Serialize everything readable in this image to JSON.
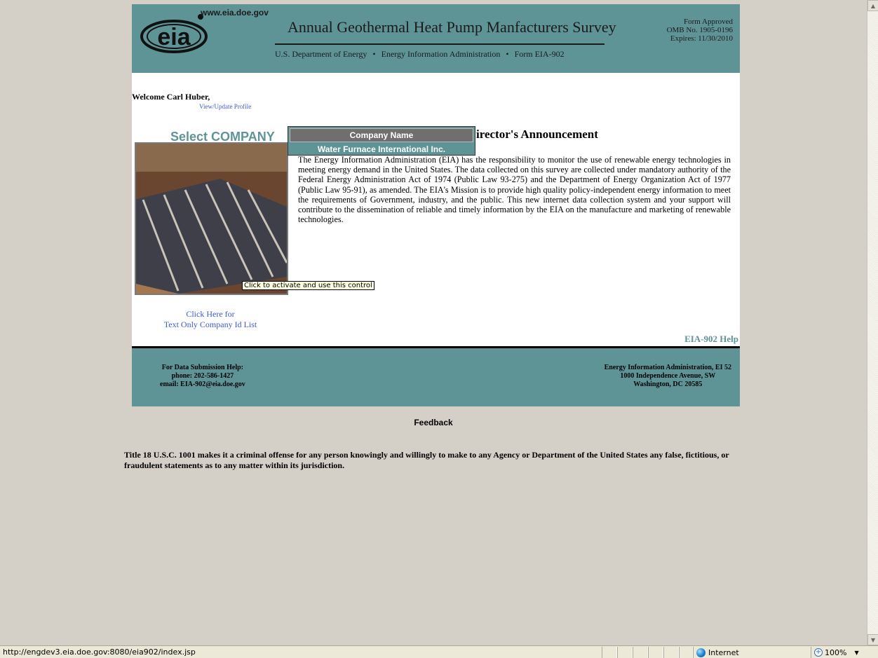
{
  "header": {
    "logo_text": "eia",
    "logo_url": "www.eia.doe.gov",
    "title": "Annual Geothermal Heat Pump Manfacturers Survey",
    "subtitle_dept": "U.S. Department of Energy",
    "subtitle_agency": "Energy Information Administration",
    "subtitle_form": "Form EIA-902",
    "subtitle_separator": "•",
    "form_approved": "Form Approved",
    "omb": "OMB No. 1905-0196",
    "expires": "Expires: 11/30/2010"
  },
  "welcome": {
    "text": "Welcome Carl Huber,",
    "profile_link": "View/Update Profile"
  },
  "company_select": {
    "heading": "Select COMPANY",
    "column_header": "Company Name",
    "companies": [
      "Water Furnace International Inc."
    ],
    "tooltip": "Click to activate and use this control"
  },
  "announcement": {
    "title": "Director's Announcement",
    "title_visible": "irector's Announcement",
    "body": "The Energy Information Administration (EIA) has the responsibility to monitor the use of renewable energy technologies in meeting energy demand in the United States. The data collected on this survey are collected under mandatory authority of the Federal Energy Administration Act of 1974 (Public Law 93-275) and the Department of Energy Organization Act of 1977 (Public Law 95-91), as amended. The EIA's Mission is to provide high quality policy-independent energy information to meet the requirements of Government, industry, and the public. This new internet data collection system and your support will contribute to the dissemination of reliable and timely information by the EIA on the manufacture and marketing of renewable technologies."
  },
  "links": {
    "text_only_line1": "Click Here for",
    "text_only_line2": "Text Only Company Id List",
    "help": "EIA-902 Help"
  },
  "footer": {
    "help_title": "For Data Submission Help:",
    "phone": "phone: 202-586-1427",
    "email": "email: EIA-902@eia.doe.gov",
    "org": "Energy Information Administration, EI 52",
    "street": "1000 Independence Avenue, SW",
    "city": "Washington, DC 20585"
  },
  "feedback": "Feedback",
  "legal": "Title 18 U.S.C. 1001 makes it a criminal offense for any person knowingly and willingly to make to any Agency or Department of the United States any false, fictitious, or fraudulent statements as to any matter within its jurisdiction.",
  "statusbar": {
    "url": "http://engdev3.eia.doe.gov:8080/eia902/index.jsp",
    "zone": "Internet",
    "zoom": "100%"
  },
  "colors": {
    "teal": "#5f9497",
    "link": "#3b5bd6"
  }
}
